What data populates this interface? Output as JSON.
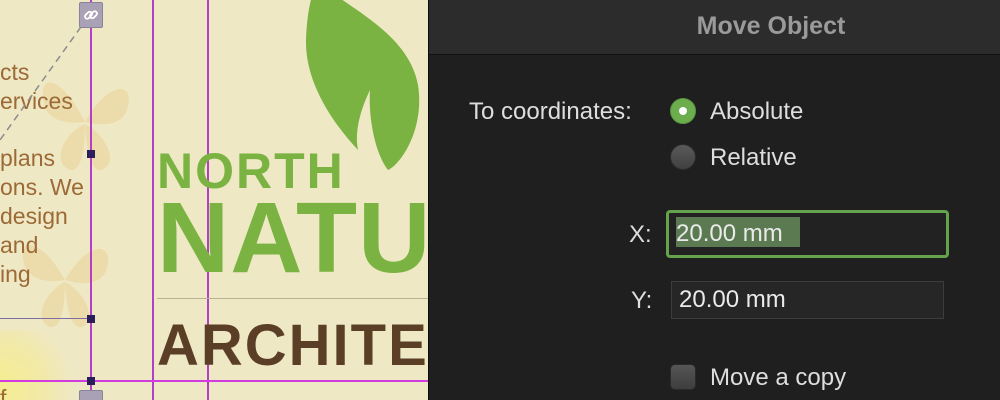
{
  "canvas": {
    "body_text_lines": [
      "cts",
      "ervices",
      "",
      "plans",
      "ons. We",
      "design",
      "and",
      "ing"
    ],
    "bottom_text": "f",
    "brand": {
      "line1": "NORTH",
      "line2": "NATU",
      "line3": "ARCHITE"
    },
    "colors": {
      "brand_green": "#7bb342",
      "brand_brown": "#5b3e26",
      "guide": "#d13be0"
    },
    "icons": {
      "link": "link-icon",
      "leaf": "leaf-logo"
    }
  },
  "dialog": {
    "title": "Move Object",
    "coordinates_label": "To coordinates:",
    "options": {
      "absolute": {
        "label": "Absolute",
        "selected": true
      },
      "relative": {
        "label": "Relative",
        "selected": false
      }
    },
    "x": {
      "label": "X:",
      "value": "20.00 mm"
    },
    "y": {
      "label": "Y:",
      "value": "20.00 mm"
    },
    "move_copy": {
      "label": "Move a copy",
      "checked": false
    },
    "colors": {
      "accent": "#6cad4e"
    }
  }
}
